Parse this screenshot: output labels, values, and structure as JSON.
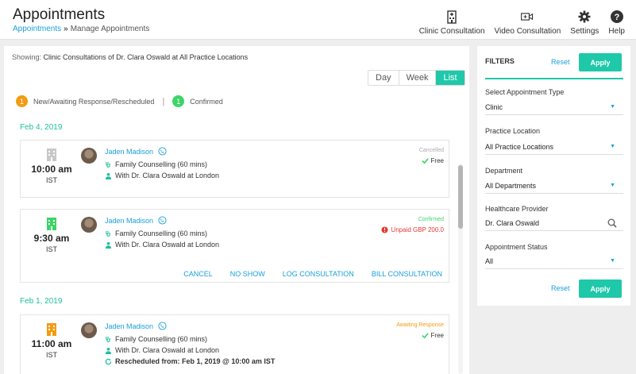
{
  "header": {
    "title": "Appointments",
    "breadcrumb": {
      "link": "Appointments",
      "separator": "»",
      "current": "Manage Appointments"
    },
    "actions": [
      {
        "label": "Clinic Consultation",
        "icon": "hospital-icon"
      },
      {
        "label": "Video Consultation",
        "icon": "video-plus-icon"
      },
      {
        "label": "Settings",
        "icon": "gear-icon"
      },
      {
        "label": "Help",
        "icon": "help-icon"
      }
    ]
  },
  "main": {
    "showing_prefix": "Showing:",
    "showing_text": "Clinic Consultations of Dr. Clara Oswald at All Practice Locations",
    "view_tabs": [
      "Day",
      "Week",
      "List"
    ],
    "active_view": "List",
    "legend": [
      {
        "count": "1",
        "label": "New/Awaiting Response/Rescheduled",
        "color": "#f39c12"
      },
      {
        "count": "1",
        "label": "Confirmed",
        "color": "#3dd468"
      }
    ],
    "legend_divider": "|",
    "groups": [
      {
        "date": "Feb 4, 2019",
        "appointments": [
          {
            "time": "10:00 am",
            "tz": "IST",
            "patient": "Jaden Madison",
            "service": "Family Counselling (60 mins)",
            "doctor": "With Dr. Clara Oswald at London",
            "status": "Cancelled",
            "sub_status": "Free",
            "icon_color": "#c8c8c8"
          },
          {
            "time": "9:30 am",
            "tz": "IST",
            "patient": "Jaden Madison",
            "service": "Family Counselling (60 mins)",
            "doctor": "With Dr. Clara Oswald at London",
            "status": "Confirmed",
            "sub_status": "Unpaid GBP 200.0",
            "icon_color": "#3dd468",
            "actions": [
              "CANCEL",
              "NO SHOW",
              "LOG CONSULTATION",
              "BILL CONSULTATION"
            ]
          }
        ]
      },
      {
        "date": "Feb 1, 2019",
        "appointments": [
          {
            "time": "11:00 am",
            "tz": "IST",
            "patient": "Jaden Madison",
            "service": "Family Counselling (60 mins)",
            "doctor": "With Dr. Clara Oswald at London",
            "rescheduled": "Rescheduled from: Feb 1, 2019 @ 10:00 am IST",
            "status": "Awaiting Response",
            "sub_status": "Free",
            "icon_color": "#f39c12"
          }
        ]
      }
    ]
  },
  "filters": {
    "title": "FILTERS",
    "reset": "Reset",
    "apply": "Apply",
    "fields": [
      {
        "label": "Select Appointment Type",
        "value": "Clinic",
        "kind": "select"
      },
      {
        "label": "Practice Location",
        "value": "All Practice Locations",
        "kind": "select"
      },
      {
        "label": "Department",
        "value": "All Departments",
        "kind": "select"
      },
      {
        "label": "Healthcare Provider",
        "value": "Dr. Clara Oswald",
        "kind": "search"
      },
      {
        "label": "Appointment Status",
        "value": "All",
        "kind": "select"
      }
    ]
  },
  "colors": {
    "accent": "#1fc8a9",
    "link": "#1a9fd9",
    "orange": "#f39c12",
    "green": "#3dd468",
    "red": "#e53935"
  }
}
